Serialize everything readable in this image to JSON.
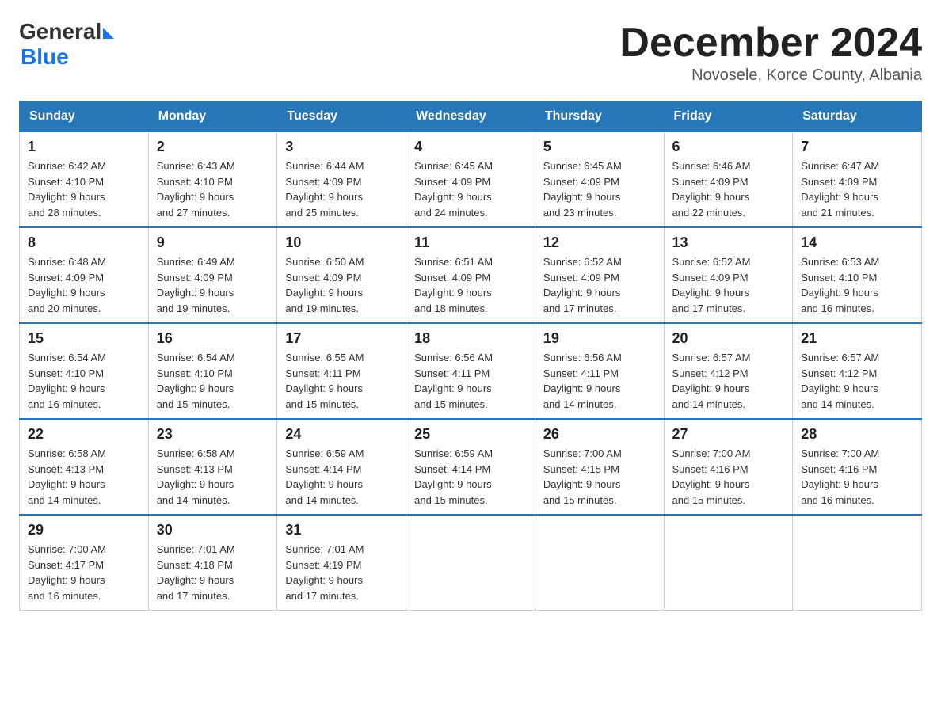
{
  "header": {
    "logo_general": "General",
    "logo_blue": "Blue",
    "title": "December 2024",
    "location": "Novosele, Korce County, Albania"
  },
  "weekdays": [
    "Sunday",
    "Monday",
    "Tuesday",
    "Wednesday",
    "Thursday",
    "Friday",
    "Saturday"
  ],
  "weeks": [
    [
      {
        "day": "1",
        "sunrise": "6:42 AM",
        "sunset": "4:10 PM",
        "daylight": "9 hours and 28 minutes."
      },
      {
        "day": "2",
        "sunrise": "6:43 AM",
        "sunset": "4:10 PM",
        "daylight": "9 hours and 27 minutes."
      },
      {
        "day": "3",
        "sunrise": "6:44 AM",
        "sunset": "4:09 PM",
        "daylight": "9 hours and 25 minutes."
      },
      {
        "day": "4",
        "sunrise": "6:45 AM",
        "sunset": "4:09 PM",
        "daylight": "9 hours and 24 minutes."
      },
      {
        "day": "5",
        "sunrise": "6:45 AM",
        "sunset": "4:09 PM",
        "daylight": "9 hours and 23 minutes."
      },
      {
        "day": "6",
        "sunrise": "6:46 AM",
        "sunset": "4:09 PM",
        "daylight": "9 hours and 22 minutes."
      },
      {
        "day": "7",
        "sunrise": "6:47 AM",
        "sunset": "4:09 PM",
        "daylight": "9 hours and 21 minutes."
      }
    ],
    [
      {
        "day": "8",
        "sunrise": "6:48 AM",
        "sunset": "4:09 PM",
        "daylight": "9 hours and 20 minutes."
      },
      {
        "day": "9",
        "sunrise": "6:49 AM",
        "sunset": "4:09 PM",
        "daylight": "9 hours and 19 minutes."
      },
      {
        "day": "10",
        "sunrise": "6:50 AM",
        "sunset": "4:09 PM",
        "daylight": "9 hours and 19 minutes."
      },
      {
        "day": "11",
        "sunrise": "6:51 AM",
        "sunset": "4:09 PM",
        "daylight": "9 hours and 18 minutes."
      },
      {
        "day": "12",
        "sunrise": "6:52 AM",
        "sunset": "4:09 PM",
        "daylight": "9 hours and 17 minutes."
      },
      {
        "day": "13",
        "sunrise": "6:52 AM",
        "sunset": "4:09 PM",
        "daylight": "9 hours and 17 minutes."
      },
      {
        "day": "14",
        "sunrise": "6:53 AM",
        "sunset": "4:10 PM",
        "daylight": "9 hours and 16 minutes."
      }
    ],
    [
      {
        "day": "15",
        "sunrise": "6:54 AM",
        "sunset": "4:10 PM",
        "daylight": "9 hours and 16 minutes."
      },
      {
        "day": "16",
        "sunrise": "6:54 AM",
        "sunset": "4:10 PM",
        "daylight": "9 hours and 15 minutes."
      },
      {
        "day": "17",
        "sunrise": "6:55 AM",
        "sunset": "4:11 PM",
        "daylight": "9 hours and 15 minutes."
      },
      {
        "day": "18",
        "sunrise": "6:56 AM",
        "sunset": "4:11 PM",
        "daylight": "9 hours and 15 minutes."
      },
      {
        "day": "19",
        "sunrise": "6:56 AM",
        "sunset": "4:11 PM",
        "daylight": "9 hours and 14 minutes."
      },
      {
        "day": "20",
        "sunrise": "6:57 AM",
        "sunset": "4:12 PM",
        "daylight": "9 hours and 14 minutes."
      },
      {
        "day": "21",
        "sunrise": "6:57 AM",
        "sunset": "4:12 PM",
        "daylight": "9 hours and 14 minutes."
      }
    ],
    [
      {
        "day": "22",
        "sunrise": "6:58 AM",
        "sunset": "4:13 PM",
        "daylight": "9 hours and 14 minutes."
      },
      {
        "day": "23",
        "sunrise": "6:58 AM",
        "sunset": "4:13 PM",
        "daylight": "9 hours and 14 minutes."
      },
      {
        "day": "24",
        "sunrise": "6:59 AM",
        "sunset": "4:14 PM",
        "daylight": "9 hours and 14 minutes."
      },
      {
        "day": "25",
        "sunrise": "6:59 AM",
        "sunset": "4:14 PM",
        "daylight": "9 hours and 15 minutes."
      },
      {
        "day": "26",
        "sunrise": "7:00 AM",
        "sunset": "4:15 PM",
        "daylight": "9 hours and 15 minutes."
      },
      {
        "day": "27",
        "sunrise": "7:00 AM",
        "sunset": "4:16 PM",
        "daylight": "9 hours and 15 minutes."
      },
      {
        "day": "28",
        "sunrise": "7:00 AM",
        "sunset": "4:16 PM",
        "daylight": "9 hours and 16 minutes."
      }
    ],
    [
      {
        "day": "29",
        "sunrise": "7:00 AM",
        "sunset": "4:17 PM",
        "daylight": "9 hours and 16 minutes."
      },
      {
        "day": "30",
        "sunrise": "7:01 AM",
        "sunset": "4:18 PM",
        "daylight": "9 hours and 17 minutes."
      },
      {
        "day": "31",
        "sunrise": "7:01 AM",
        "sunset": "4:19 PM",
        "daylight": "9 hours and 17 minutes."
      },
      null,
      null,
      null,
      null
    ]
  ],
  "labels": {
    "sunrise": "Sunrise:",
    "sunset": "Sunset:",
    "daylight": "Daylight:"
  }
}
